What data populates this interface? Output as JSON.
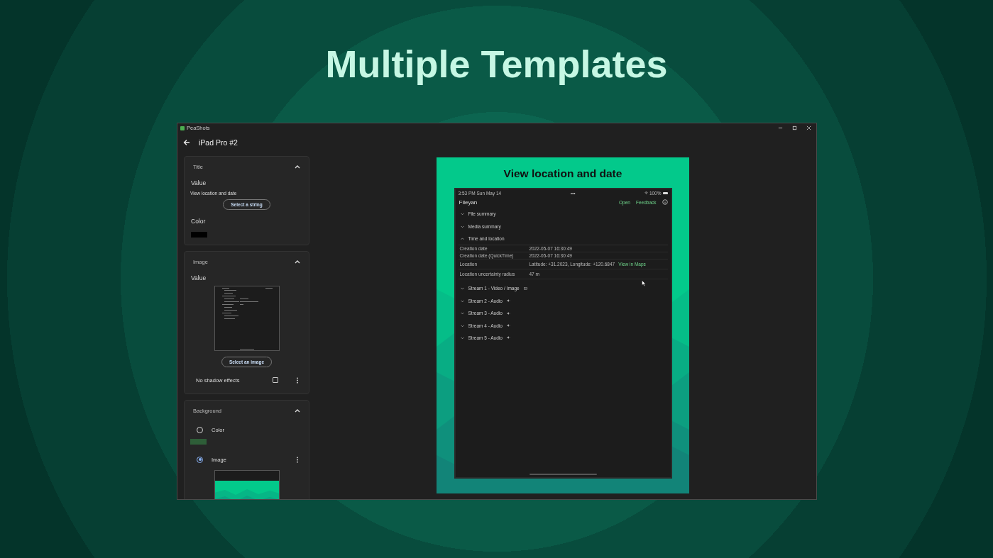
{
  "headline": "Multiple Templates",
  "window": {
    "title": "PeaShots"
  },
  "page_title": "iPad Pro #2",
  "sections": [
    {
      "kind": "title",
      "heading": "Title",
      "expanded": true,
      "value_label": "Value",
      "value": "View location and date",
      "button": "Select a string",
      "color_label": "Color",
      "color": "#000000"
    },
    {
      "kind": "image",
      "heading": "Image",
      "expanded": true,
      "value_label": "Value",
      "button": "Select an image",
      "shadow_label": "No shadow effects",
      "shadow_checked": false
    },
    {
      "kind": "background",
      "heading": "Background",
      "expanded": true,
      "options": [
        {
          "label": "Color",
          "selected": false,
          "color": "#2e5e38"
        },
        {
          "label": "Image",
          "selected": true
        }
      ]
    }
  ],
  "preview": {
    "title": "View location and date",
    "status": {
      "time": "3:53 PM  Sun May 14",
      "dots": "•••",
      "battery": "100%"
    },
    "app_title": "Fileyan",
    "actions": [
      "Open",
      "Feedback"
    ],
    "groups": [
      {
        "label": "File summary",
        "expanded": false
      },
      {
        "label": "Media summary",
        "expanded": false
      },
      {
        "label": "Time and location",
        "expanded": true,
        "rows": [
          {
            "label": "Creation date",
            "value": "2022-05-07 16:30:49"
          },
          {
            "label": "Creation date (QuickTime)",
            "value": "2022-05-07 16:30:49"
          },
          {
            "label": "Location",
            "value": "Latitude: +31.2023, Longitude: +120.6847",
            "link": "View in Maps"
          },
          {
            "label": "Location uncertainty radius",
            "value": "47 m"
          }
        ]
      },
      {
        "label": "Stream 1 - Video / Image",
        "expanded": false,
        "kind": "video"
      },
      {
        "label": "Stream 2 - Audio",
        "expanded": false,
        "kind": "audio"
      },
      {
        "label": "Stream 3 - Audio",
        "expanded": false,
        "kind": "audio"
      },
      {
        "label": "Stream 4 - Audio",
        "expanded": false,
        "kind": "audio"
      },
      {
        "label": "Stream 5 - Audio",
        "expanded": false,
        "kind": "audio"
      }
    ]
  }
}
